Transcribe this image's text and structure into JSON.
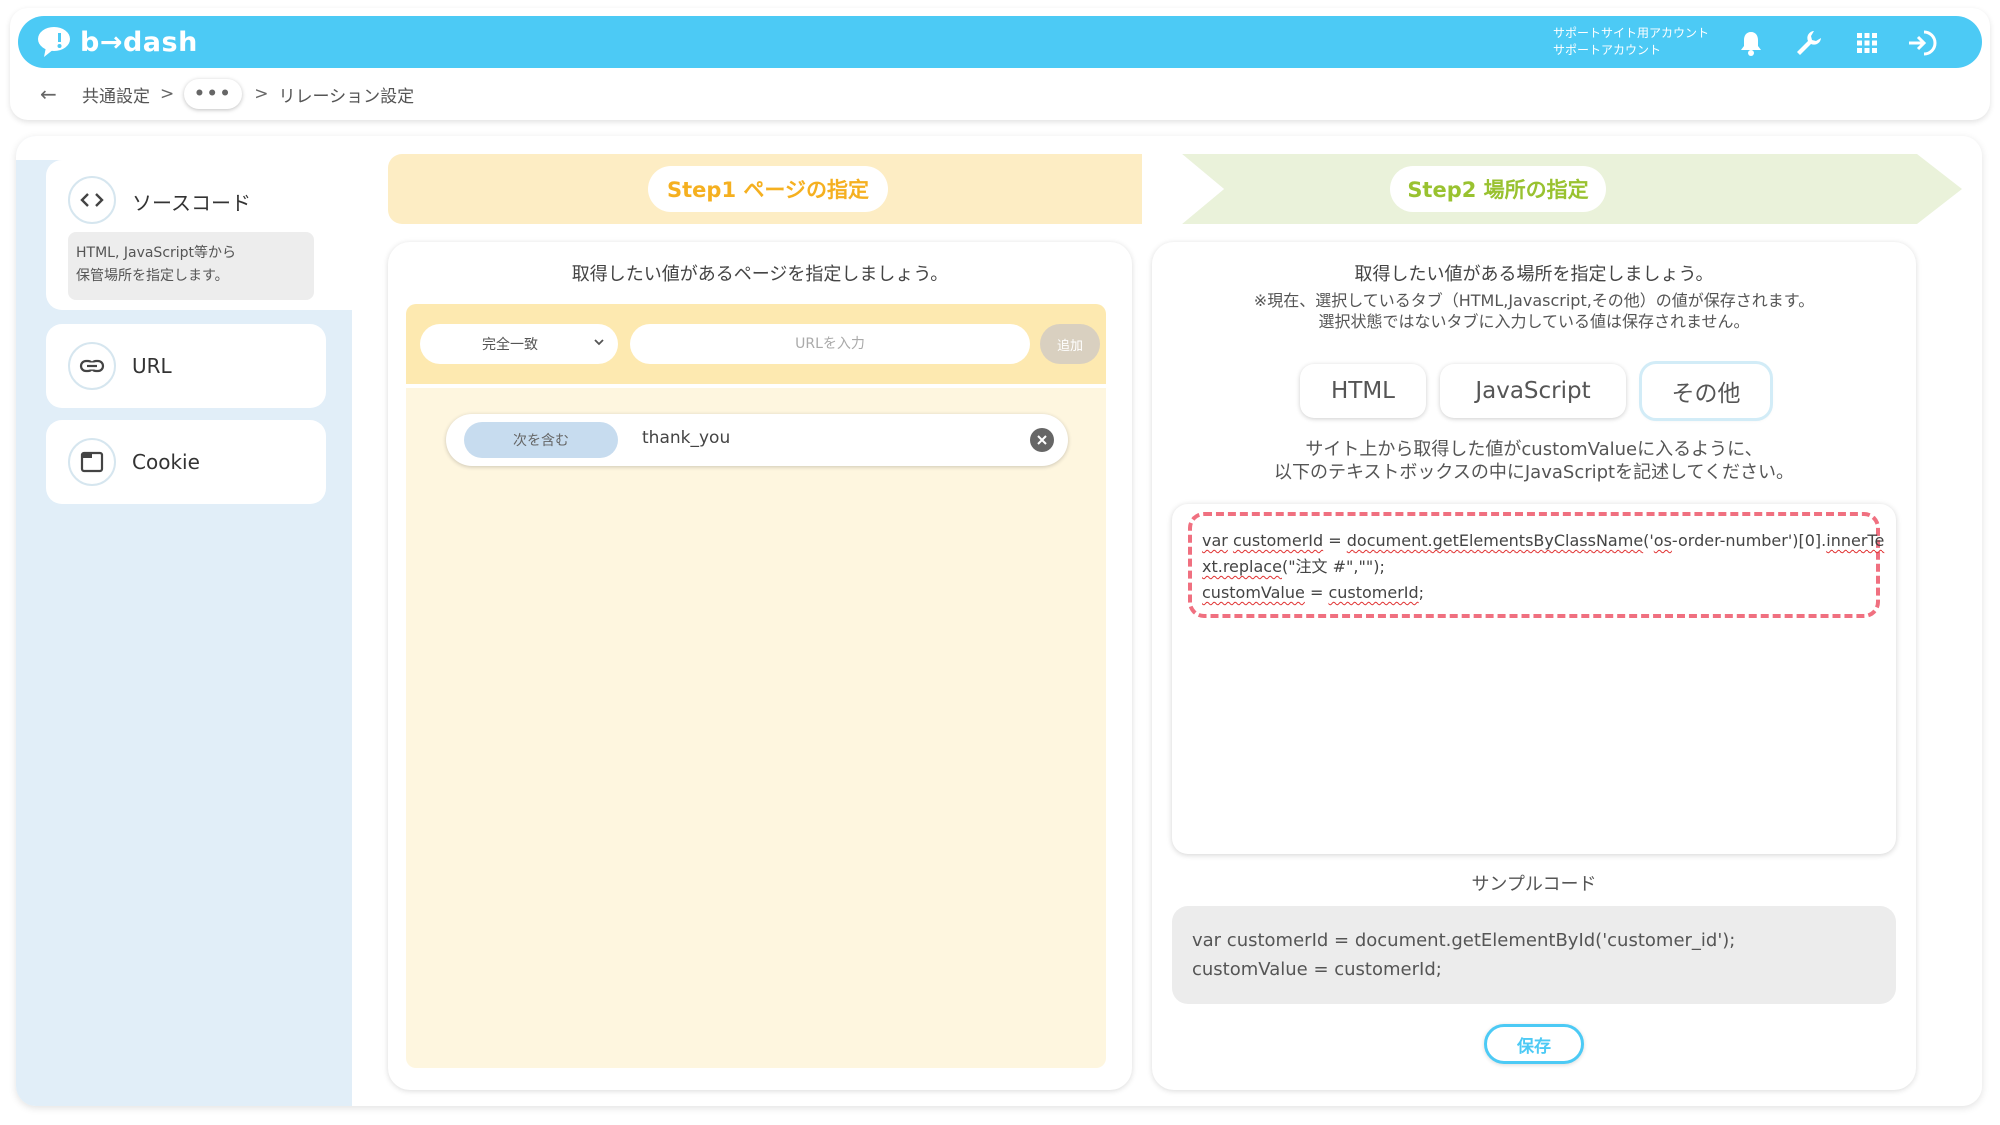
{
  "header": {
    "logo_text": "b→dash",
    "account_line1": "サポートサイト用アカウント",
    "account_line2": "サポートアカウント",
    "accent_color": "#4ccaf5"
  },
  "breadcrumb": {
    "back_icon": "←",
    "item1": "共通設定",
    "sep": ">",
    "ellipsis": "•••",
    "current": "リレーション設定"
  },
  "sidebar": {
    "items": [
      {
        "label": "ソースコード",
        "icon": "code-icon",
        "desc_line1": "HTML, JavaScript等から",
        "desc_line2": "保管場所を指定します。"
      },
      {
        "label": "URL",
        "icon": "link-icon"
      },
      {
        "label": "Cookie",
        "icon": "window-icon"
      }
    ]
  },
  "steps": {
    "step1": "Step1 ページの指定",
    "step2": "Step2 場所の指定"
  },
  "left_panel": {
    "title": "取得したい値があるページを指定しましょう。",
    "match_select": "完全一致",
    "url_placeholder": "URLを入力",
    "add_label": "追加",
    "conditions": [
      {
        "type": "次を含む",
        "value": "thank_you"
      }
    ]
  },
  "right_panel": {
    "title": "取得したい値がある場所を指定しましょう。",
    "notice_line1": "※現在、選択しているタブ（HTML,Javascript,その他）の値が保存されます。",
    "notice_line2": "選択状態ではないタブに入力している値は保存されません。",
    "tabs": [
      {
        "label": "HTML"
      },
      {
        "label": "JavaScript"
      },
      {
        "label": "その他"
      }
    ],
    "instruction_line1": "サイト上から取得した値がcustomValueに入るように、",
    "instruction_line2": "以下のテキストボックスの中にJavaScriptを記述してください。",
    "code": {
      "t1": "var",
      "t2": " ",
      "t3": "customerId",
      "t4": " = ",
      "t5": "document.getElementsByClassName",
      "t6": "('",
      "t7": "os",
      "t8": "-order-number')[0].",
      "t9": "innerText.replace",
      "t10": "(\"注文 #\",\"\");",
      "t11": "customValue",
      "t12": " = ",
      "t13": "customerId",
      "t14": ";"
    },
    "sample_title": "サンプルコード",
    "sample_line1": "var customerId = document.getElementById('customer_id');",
    "sample_line2": "customValue = customerId;",
    "save_label": "保存"
  }
}
